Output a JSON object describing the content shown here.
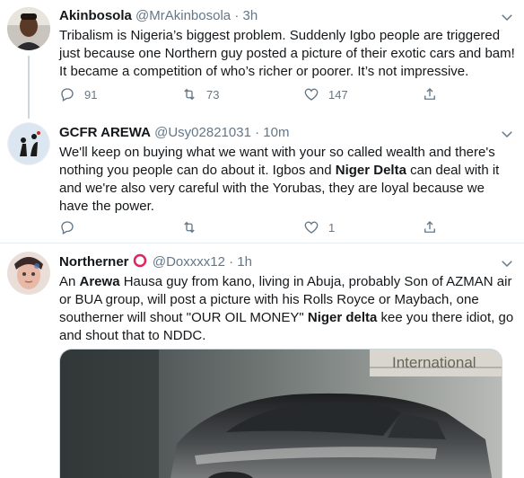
{
  "colors": {
    "text": "#14171a",
    "secondary": "#657786",
    "divider": "#e6ecf0",
    "thread": "#ccd6dd"
  },
  "tweets": [
    {
      "name": "Akinbosola",
      "handle": "@MrAkinbosola",
      "sep": "·",
      "time": "3h",
      "text": "Tribalism is Nigeria’s biggest problem. Suddenly Igbo people are triggered just because one Northern guy posted a picture of their exotic cars and bam! It became a competition of who’s richer or poorer. It’s not impressive.",
      "replies": "91",
      "retweets": "73",
      "likes": "147"
    },
    {
      "name": "GCFR AREWA",
      "handle": "@Usy02821031",
      "sep": "·",
      "time": "10m",
      "text_a": "We'll keep on buying what we want with your so called wealth and there's nothing you people can do about it. Igbos and ",
      "text_b": "Niger Delta",
      "text_c": " can deal with it and we're also very careful with the Yorubas, they are loyal because we have the power.",
      "likes": "1"
    },
    {
      "name": "Northerner",
      "handle": "@Doxxxx12",
      "sep": "·",
      "time": "1h",
      "text_a": "An ",
      "text_b": "Arewa",
      "text_c": " Hausa guy from kano, living in Abuja, probably Son of AZMAN air or BUA group, will post a picture with his Rolls Royce or Maybach, one southerner will shout \"OUR OIL MONEY\" ",
      "text_d": "Niger delta",
      "text_e": " kee you there idiot, go and shout that to NDDC.",
      "media_caption": "International"
    }
  ],
  "icons": {
    "reply": "reply-icon",
    "retweet": "retweet-icon",
    "like": "heart-icon",
    "share": "share-icon",
    "caret": "chevron-down-icon",
    "emoji": "red-circle-emoji-icon"
  }
}
